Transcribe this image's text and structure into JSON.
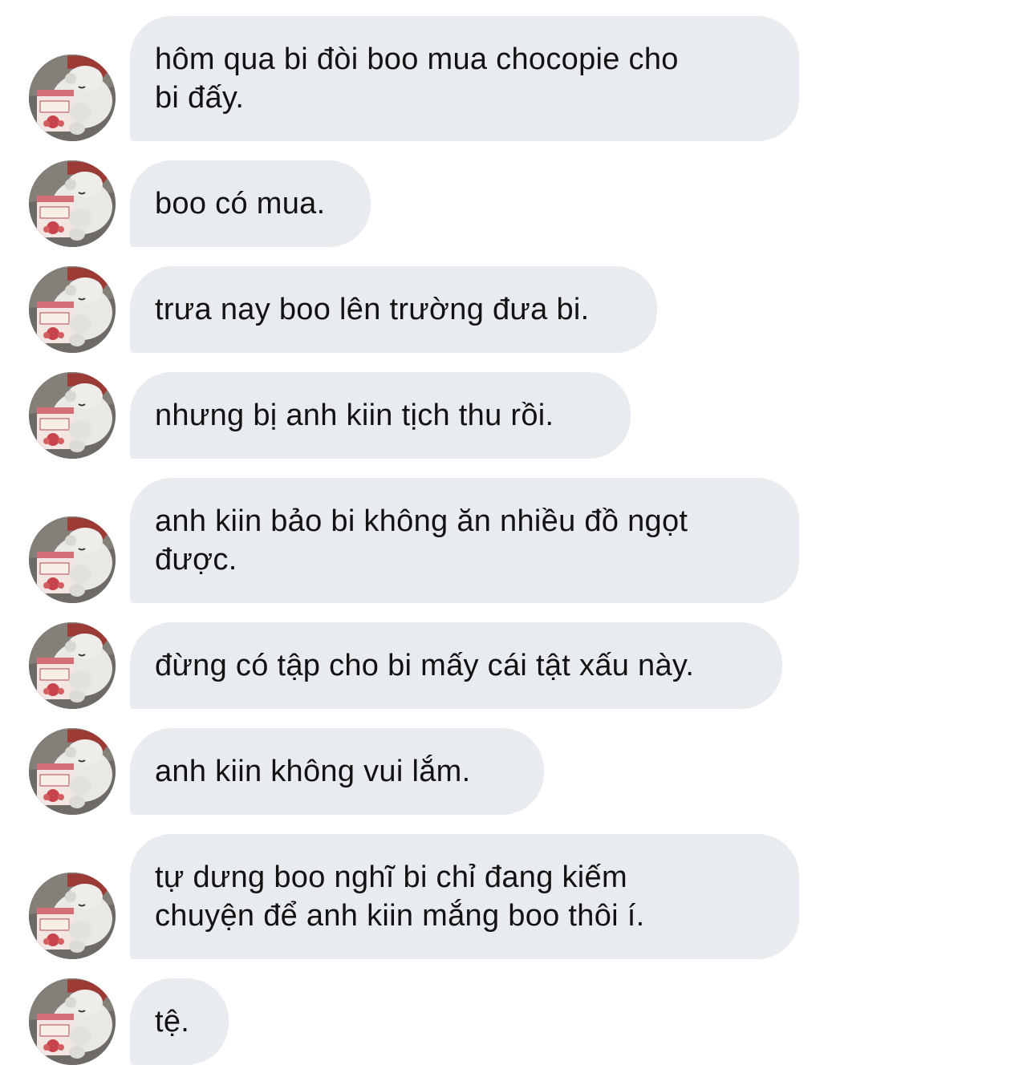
{
  "conversation": {
    "messages": [
      {
        "text": "hôm qua bi đòi boo mua chocopie cho\nbi đấy."
      },
      {
        "text": "boo có mua."
      },
      {
        "text": "trưa nay boo lên trường đưa bi."
      },
      {
        "text": "nhưng bị anh kiin tịch thu rồi."
      },
      {
        "text": "anh kiin bảo bi không ăn nhiều đồ ngọt\nđược."
      },
      {
        "text": "đừng có tập cho bi mấy cái tật xấu này."
      },
      {
        "text": "anh kiin không vui lắm."
      },
      {
        "text": "tự dưng boo nghĩ bi chỉ đang kiếm\nchuyện để anh kiin mắng boo thôi í."
      },
      {
        "text": "tệ."
      }
    ]
  },
  "colors": {
    "bubble_background": "#e8ecf0",
    "text": "#121212",
    "page_background": "#ffffff"
  },
  "icons": {
    "avatar": "bear-with-ice-cream-cup-avatar"
  }
}
